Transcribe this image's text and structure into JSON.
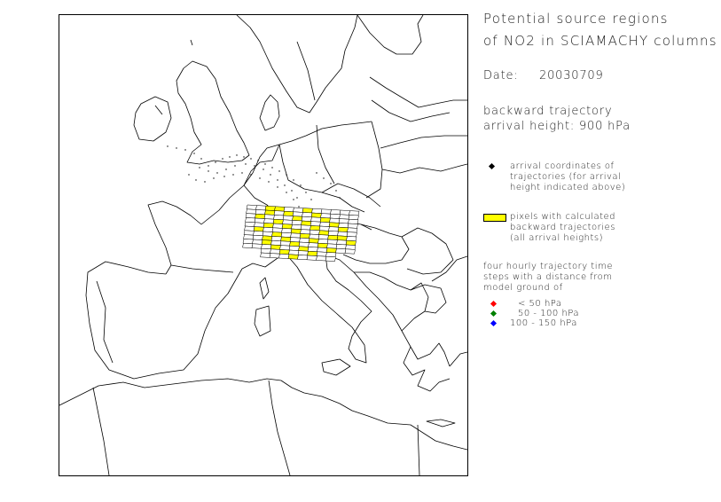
{
  "title": {
    "line1": "Potential source regions",
    "line2": "of NO2 in SCIAMACHY columns"
  },
  "date": {
    "label": "Date:",
    "value": "20030709"
  },
  "trajectory": {
    "line1": "backward trajectory",
    "line2": "arrival height: 900 hPa"
  },
  "legend": {
    "arrival": {
      "lines": [
        "arrival coordinates of",
        "trajectories (for arrival",
        "height indicated above)"
      ],
      "color": "#000000"
    },
    "pixels": {
      "lines": [
        "pixels with calculated",
        "backward trajectories",
        "(all arrival heights)"
      ],
      "color": "#ffff00"
    },
    "timesteps": {
      "lines": [
        "four hourly trajectory time",
        "steps with a distance from",
        "model ground of"
      ],
      "items": [
        {
          "label": "< 50 hPa",
          "color": "#ff0000"
        },
        {
          "label": "50 - 100 hPa",
          "color": "#008000"
        },
        {
          "label": "100 - 150 hPa",
          "color": "#0000ff"
        }
      ]
    }
  }
}
